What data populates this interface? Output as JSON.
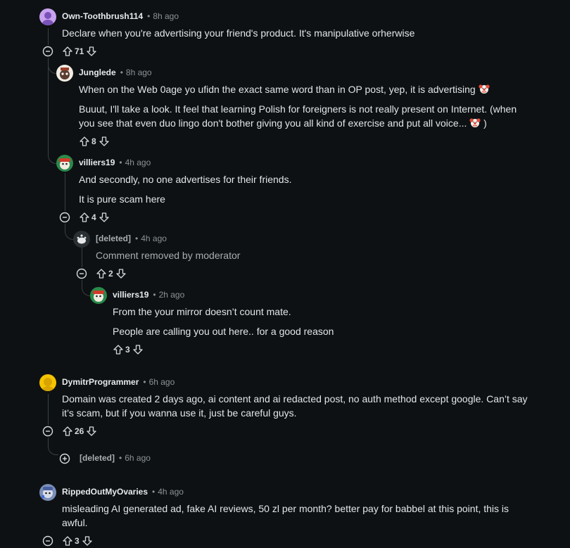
{
  "comments": [
    {
      "author": "Own-Toothbrush114",
      "time": "8h ago",
      "text": [
        "Declare when you're advertising your friend's product. It's manipulative orherwise"
      ],
      "score": "71",
      "avatar_color": "#c8a2f0"
    },
    {
      "author": "Junglede",
      "time": "8h ago",
      "text": [
        "When on the Web 0age yo ufidn the exact same word than in OP post, yep, it is advertising",
        "Buuut, I'll take a look. It feel that learning Polish for foreigners is not really present on Internet. (when",
        "you see that even duo lingo don't bother giving you all kind of exercise and put all voice...",
        ")"
      ],
      "score": "8"
    },
    {
      "author": "villiers19",
      "time": "4h ago",
      "text": [
        "And secondly, no one advertises for their friends.",
        "It is pure scam here"
      ],
      "score": "4"
    },
    {
      "author": "[deleted]",
      "time": "4h ago",
      "text": [
        "Comment removed by moderator"
      ],
      "score": "2"
    },
    {
      "author": "villiers19",
      "time": "2h ago",
      "text": [
        "From the your mirror doesn’t count mate.",
        "People are calling you out here.. for a good reason"
      ],
      "score": "3"
    },
    {
      "author": "DymitrProgrammer",
      "time": "6h ago",
      "text": [
        "Domain was created 2 days ago, ai content and ai redacted post, no auth method except google. Can’t say",
        "it’s scam, but if you wanna use it, just be careful guys."
      ],
      "score": "26",
      "avatar_color": "#f5c400"
    },
    {
      "author": "[deleted]",
      "time": "6h ago"
    },
    {
      "author": "RippedOutMyOvaries",
      "time": "4h ago",
      "text": [
        "misleading AI generated ad, fake AI reviews, 50 zl per month? better pay for babbel at this point, this is",
        "awful."
      ],
      "score": "3"
    }
  ],
  "icons": {
    "upvote": "upvote-icon",
    "downvote": "downvote-icon",
    "collapse": "collapse-icon",
    "expand": "expand-icon",
    "clown": "clown-face-emoji"
  }
}
